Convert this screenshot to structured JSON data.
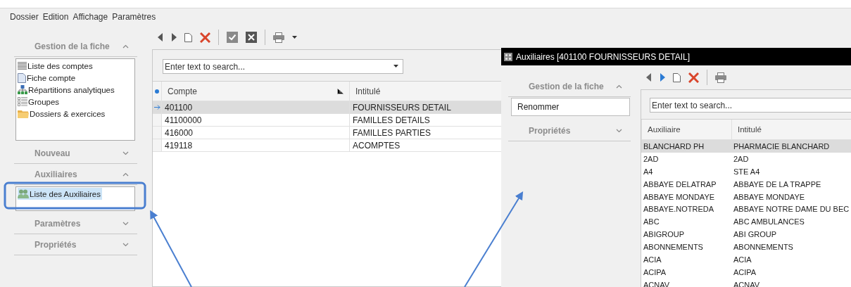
{
  "menu": [
    "Dossier",
    "Edition",
    "Affichage",
    "Paramètres"
  ],
  "sidebar": {
    "sections": [
      {
        "title": "Gestion de la fiche",
        "expanded": true,
        "items": [
          {
            "label": "Liste des comptes",
            "kind": "list",
            "selected": false
          },
          {
            "label": "Fiche compte",
            "kind": "form",
            "selected": false
          },
          {
            "label": "Répartitions analytiques",
            "kind": "hierarchy",
            "selected": false
          },
          {
            "label": "Groupes",
            "kind": "groups",
            "selected": false
          },
          {
            "label": "Dossiers & exercices",
            "kind": "folder",
            "selected": false
          }
        ]
      },
      {
        "title": "Nouveau",
        "expanded": false
      },
      {
        "title": "Auxiliaires",
        "expanded": true,
        "items": [
          {
            "label": "Liste des Auxiliaires",
            "kind": "people",
            "selected": true
          }
        ]
      },
      {
        "title": "Paramètres",
        "expanded": false
      },
      {
        "title": "Propriétés",
        "expanded": false
      }
    ]
  },
  "search": {
    "placeholder": "Enter text to search..."
  },
  "table": {
    "columns": [
      "Compte",
      "Intitulé"
    ],
    "rows": [
      {
        "cells": [
          "401100",
          "FOURNISSEURS DETAIL"
        ],
        "selected": true
      },
      {
        "cells": [
          "41100000",
          "FAMILLES DETAILS"
        ],
        "selected": false
      },
      {
        "cells": [
          "416000",
          "FAMILLES PARTIES"
        ],
        "selected": false
      },
      {
        "cells": [
          "419118",
          "ACOMPTES"
        ],
        "selected": false
      }
    ]
  },
  "window": {
    "title": "Auxiliaires [401100 FOURNISSEURS DETAIL]",
    "sidebar": {
      "sections": [
        {
          "title": "Gestion de la fiche",
          "expanded": true,
          "items": [
            {
              "label": "Renommer",
              "kind": "plain",
              "selected": false
            }
          ]
        },
        {
          "title": "Propriétés",
          "expanded": false
        }
      ]
    },
    "search": {
      "placeholder": "Enter text to search..."
    },
    "table": {
      "columns": [
        "Auxiliaire",
        "Intitulé"
      ],
      "rows": [
        {
          "cells": [
            "BLANCHARD PH",
            "PHARMACIE BLANCHARD"
          ],
          "selected": true
        },
        {
          "cells": [
            "2AD",
            "2AD"
          ],
          "selected": false
        },
        {
          "cells": [
            "A4",
            "STE A4"
          ],
          "selected": false
        },
        {
          "cells": [
            "ABBAYE DELATRAP",
            "ABBAYE DE LA TRAPPE"
          ],
          "selected": false
        },
        {
          "cells": [
            "ABBAYE MONDAYE",
            "ABBAYE MONDAYE"
          ],
          "selected": false
        },
        {
          "cells": [
            "ABBAYE.NOTREDA",
            "ABBAYE NOTRE DAME DU BEC"
          ],
          "selected": false
        },
        {
          "cells": [
            "ABC",
            "ABC AMBULANCES"
          ],
          "selected": false
        },
        {
          "cells": [
            "ABIGROUP",
            "ABI GROUP"
          ],
          "selected": false
        },
        {
          "cells": [
            "ABONNEMENTS",
            "ABONNEMENTS"
          ],
          "selected": false
        },
        {
          "cells": [
            "ACIA",
            "ACIA"
          ],
          "selected": false
        },
        {
          "cells": [
            "ACIPA",
            "ACIPA"
          ],
          "selected": false
        },
        {
          "cells": [
            "ACNAV",
            "ACNAV"
          ],
          "selected": false
        }
      ]
    }
  }
}
